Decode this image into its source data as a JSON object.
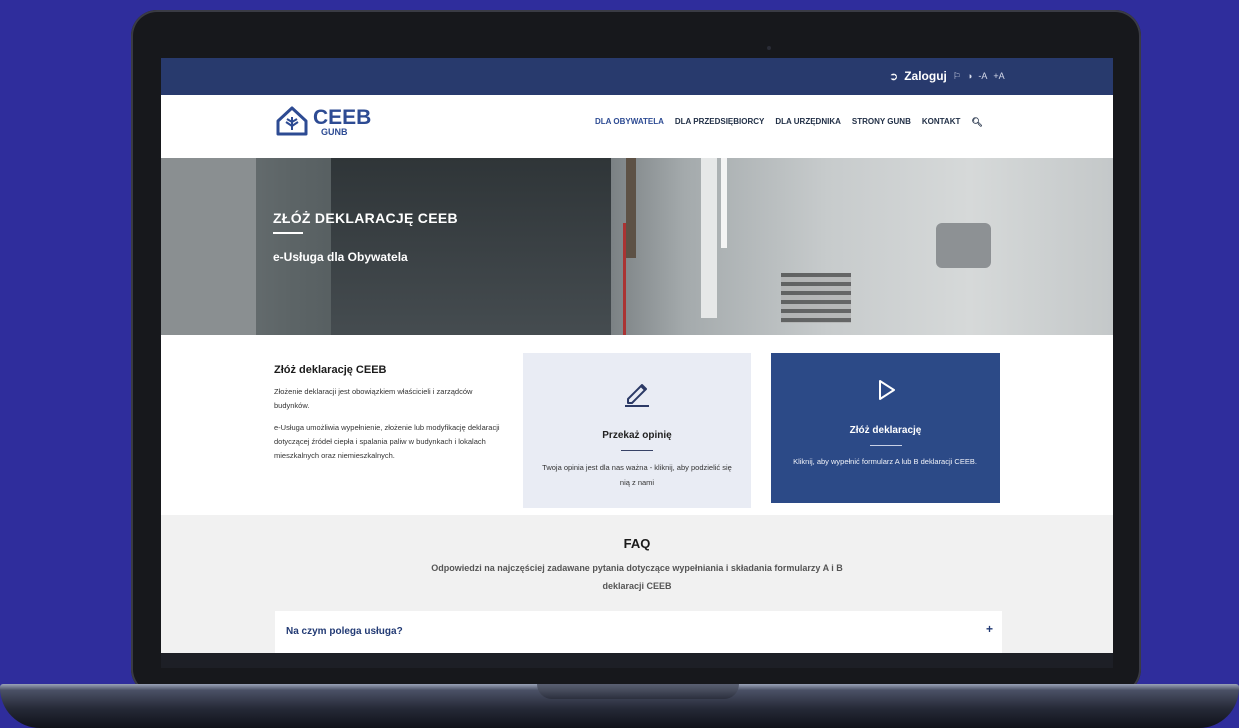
{
  "topbar": {
    "login_label": "Zaloguj",
    "icons": [
      "login-icon",
      "flag-icon",
      "contrast-icon",
      "font-decrease-icon",
      "font-increase-icon"
    ],
    "font_small": "-A",
    "font_large": "+A"
  },
  "logo": {
    "name": "CEEB",
    "sub": "GUNB"
  },
  "menu": [
    "DLA OBYWATELA",
    "DLA PRZEDSIĘBIORCY",
    "DLA URZĘDNIKA",
    "STRONY GUNB",
    "KONTAKT"
  ],
  "hero": {
    "title": "ZŁÓŻ DEKLARACJĘ CEEB",
    "subtitle": "e-Usługa dla Obywatela"
  },
  "about": {
    "title": "Złóż deklarację CEEB",
    "p1": "Złożenie deklaracji jest obowiązkiem właścicieli i zarządców budynków.",
    "p2": "e-Usługa umożliwia wypełnienie, złożenie lub modyfikację deklaracji dotyczącej źródeł ciepła i spalania paliw w budynkach i lokalach mieszkalnych oraz niemieszkalnych."
  },
  "cards": [
    {
      "title": "Przekaż opinię",
      "desc": "Twoja opinia jest dla nas ważna - kliknij, aby podzielić się nią z nami",
      "icon": "pencil-icon"
    },
    {
      "title": "Złóż deklarację",
      "desc": "Kliknij, aby wypełnić formularz A lub B deklaracji CEEB.",
      "icon": "play-icon"
    }
  ],
  "faq": {
    "title": "FAQ",
    "subtitle": "Odpowiedzi na najczęściej zadawane pytania dotyczące wypełniania i składania formularzy A i B deklaracji CEEB",
    "items": [
      {
        "question": "Na czym polega usługa?",
        "toggle": "+"
      }
    ]
  },
  "colors": {
    "brand": "#2c4a87",
    "topbar": "#283a6d",
    "page_bg": "#2f2d9c"
  }
}
